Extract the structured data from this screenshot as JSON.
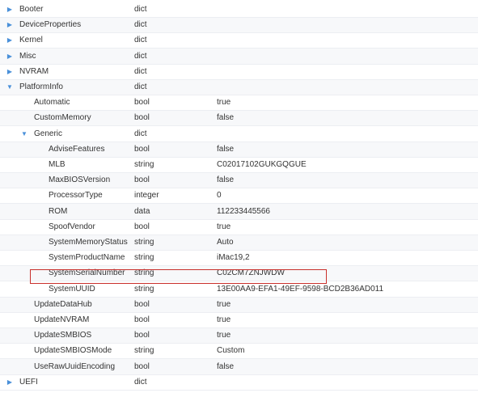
{
  "colors": {
    "arrow": "#4a90d9",
    "highlight_border": "#c9302c"
  },
  "tree": {
    "rows": [
      {
        "key": "Booter",
        "type": "dict",
        "value": "",
        "level": 0,
        "arrow": "collapsed"
      },
      {
        "key": "DeviceProperties",
        "type": "dict",
        "value": "",
        "level": 0,
        "arrow": "collapsed"
      },
      {
        "key": "Kernel",
        "type": "dict",
        "value": "",
        "level": 0,
        "arrow": "collapsed"
      },
      {
        "key": "Misc",
        "type": "dict",
        "value": "",
        "level": 0,
        "arrow": "collapsed"
      },
      {
        "key": "NVRAM",
        "type": "dict",
        "value": "",
        "level": 0,
        "arrow": "collapsed"
      },
      {
        "key": "PlatformInfo",
        "type": "dict",
        "value": "",
        "level": 0,
        "arrow": "expanded"
      },
      {
        "key": "Automatic",
        "type": "bool",
        "value": "true",
        "level": 1,
        "arrow": ""
      },
      {
        "key": "CustomMemory",
        "type": "bool",
        "value": "false",
        "level": 1,
        "arrow": ""
      },
      {
        "key": "Generic",
        "type": "dict",
        "value": "",
        "level": 1,
        "arrow": "expanded"
      },
      {
        "key": "AdviseFeatures",
        "type": "bool",
        "value": "false",
        "level": 2,
        "arrow": ""
      },
      {
        "key": "MLB",
        "type": "string",
        "value": "C02017102GUKGQGUE",
        "level": 2,
        "arrow": ""
      },
      {
        "key": "MaxBIOSVersion",
        "type": "bool",
        "value": "false",
        "level": 2,
        "arrow": ""
      },
      {
        "key": "ProcessorType",
        "type": "integer",
        "value": "0",
        "level": 2,
        "arrow": ""
      },
      {
        "key": "ROM",
        "type": "data",
        "value": "112233445566",
        "level": 2,
        "arrow": ""
      },
      {
        "key": "SpoofVendor",
        "type": "bool",
        "value": "true",
        "level": 2,
        "arrow": ""
      },
      {
        "key": "SystemMemoryStatus",
        "type": "string",
        "value": "Auto",
        "level": 2,
        "arrow": ""
      },
      {
        "key": "SystemProductName",
        "type": "string",
        "value": "iMac19,2",
        "level": 2,
        "arrow": ""
      },
      {
        "key": "SystemSerialNumber",
        "type": "string",
        "value": "C02CM7ZNJWDW",
        "level": 2,
        "arrow": "",
        "highlighted": true
      },
      {
        "key": "SystemUUID",
        "type": "string",
        "value": "13E00AA9-EFA1-49EF-9598-BCD2B36AD011",
        "level": 2,
        "arrow": ""
      },
      {
        "key": "UpdateDataHub",
        "type": "bool",
        "value": "true",
        "level": 1,
        "arrow": ""
      },
      {
        "key": "UpdateNVRAM",
        "type": "bool",
        "value": "true",
        "level": 1,
        "arrow": ""
      },
      {
        "key": "UpdateSMBIOS",
        "type": "bool",
        "value": "true",
        "level": 1,
        "arrow": ""
      },
      {
        "key": "UpdateSMBIOSMode",
        "type": "string",
        "value": "Custom",
        "level": 1,
        "arrow": ""
      },
      {
        "key": "UseRawUuidEncoding",
        "type": "bool",
        "value": "false",
        "level": 1,
        "arrow": ""
      },
      {
        "key": "UEFI",
        "type": "dict",
        "value": "",
        "level": 0,
        "arrow": "collapsed"
      }
    ]
  }
}
